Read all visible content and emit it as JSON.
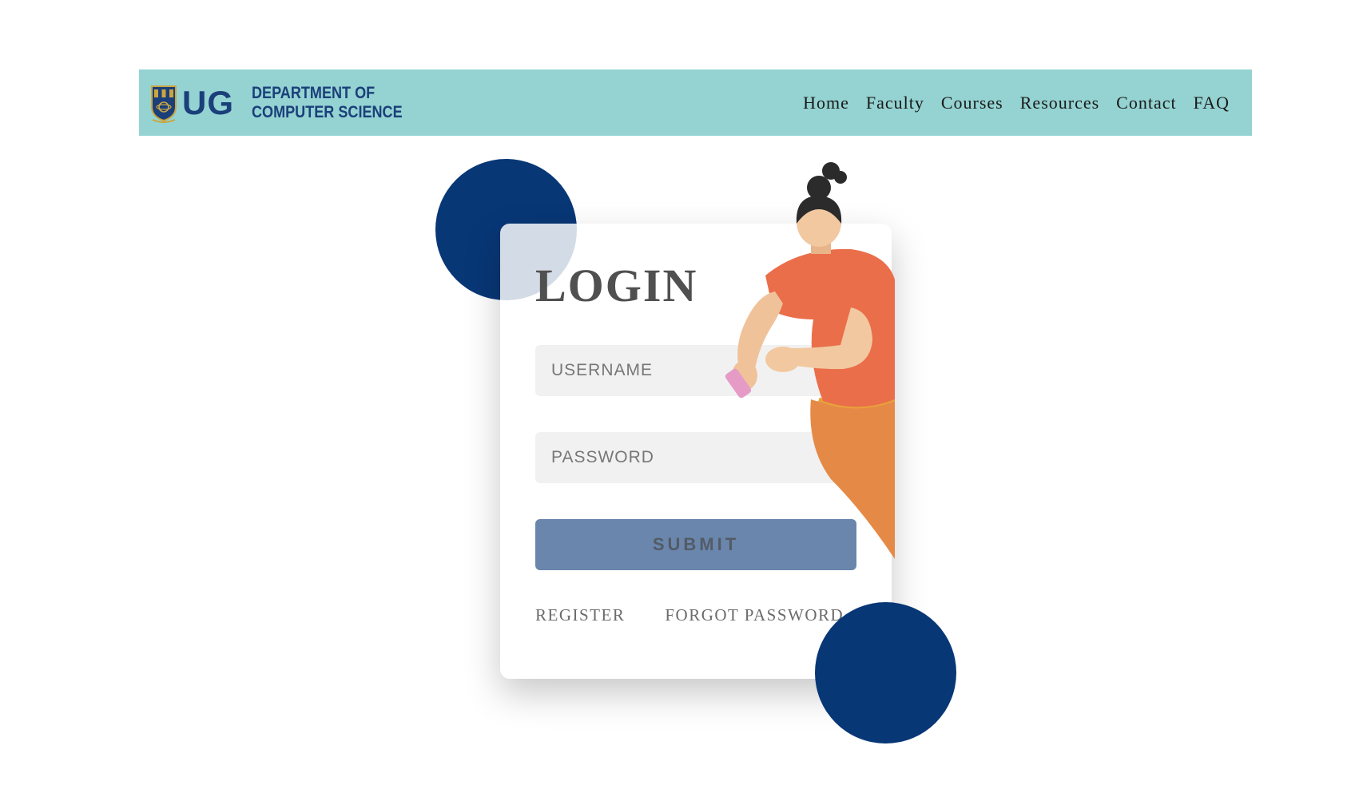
{
  "header": {
    "logo_text": "UG",
    "department_line1": "DEPARTMENT OF",
    "department_line2": "COMPUTER SCIENCE",
    "nav": [
      "Home",
      "Faculty",
      "Courses",
      "Resources",
      "Contact",
      "FAQ"
    ],
    "background_color": "#94d3d2",
    "brand_color": "#1b3f7a"
  },
  "login": {
    "title": "LOGIN",
    "username_placeholder": "USERNAME",
    "password_placeholder": "PASSWORD",
    "submit_label": "SUBMIT",
    "register_label": "REGISTER",
    "forgot_label": "FORGOT PASSWORD",
    "submit_color": "#6a86ad"
  },
  "decor": {
    "circle_color": "#083776",
    "illustration": "woman-using-phone-illustration"
  }
}
